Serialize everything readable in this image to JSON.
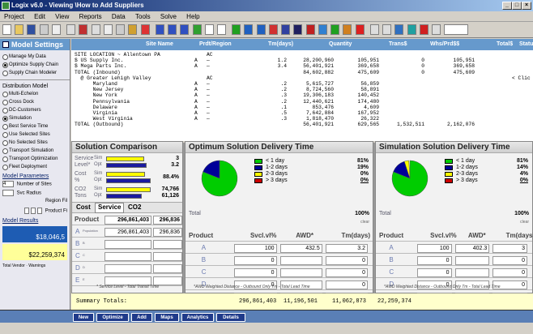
{
  "window": {
    "title": "Logix v6.0 - Viewing \\How to Add Suppliers"
  },
  "menu": [
    "Project",
    "Edit",
    "View",
    "Reports",
    "Data",
    "Tools",
    "Solve",
    "Help"
  ],
  "sidebar": {
    "title": "Model Settings",
    "solve_modes": [
      "Manage My Data",
      "Optimize Supply Chain",
      "Supply Chain Modeler"
    ],
    "distribution_title": "Distribution Model",
    "distribution_items": [
      "Multi-Echelon",
      "Cross Dock",
      "DC-Customers",
      "Simulation",
      "Best Service Time",
      "Use Selected Sites",
      "No Selected Sites",
      "Transport Simulation",
      "Transport Optimization",
      "Fleet Deployment"
    ],
    "params_title": "Model Parameters",
    "num_sites_label": "Number of Sites",
    "num_sites_value": "4",
    "svc_radius_label": "Svc Radius",
    "region_label": "Region Fil",
    "product_label": "Product Fi",
    "results_title": "Model Results",
    "result1": "$18,046,5",
    "result2": "$22,259,374",
    "total_vendor": "Total Vendor",
    "warnings": "Warnings"
  },
  "grid": {
    "headers": [
      "Site Name",
      "Prdt/Region",
      "Tm(days)",
      "Quantity",
      "Trans$",
      "Whs/Prd$$",
      "Total$",
      "Statu"
    ],
    "rows": [
      [
        "SITE LOCATION ~ Allentown PA",
        "",
        "AC",
        "",
        "",
        "",
        "",
        "",
        ""
      ],
      [
        "$ US Supply Inc.",
        "A",
        "—",
        "1.2",
        "28,200,960",
        "105,951",
        "0",
        "105,951",
        ""
      ],
      [
        "$ Mega Parts Inc.",
        "A",
        "—",
        "3.4",
        "56,401,921",
        "369,658",
        "0",
        "369,658",
        ""
      ],
      [
        "TOTAL (Inbound)",
        "",
        "",
        "",
        "84,602,882",
        "475,609",
        "0",
        "475,609",
        ""
      ],
      [
        "  @ Greater Lehigh Valley",
        "",
        "AC",
        "",
        "",
        "",
        "",
        "",
        "< Clic"
      ],
      [
        "      Maryland",
        "A",
        "—",
        ".2",
        "5,615,727",
        "56,859",
        "",
        "",
        ""
      ],
      [
        "      New Jersey",
        "A",
        "—",
        ".2",
        "8,724,560",
        "58,891",
        "",
        "",
        ""
      ],
      [
        "      New York",
        "A",
        "—",
        ".3",
        "19,306,183",
        "140,452",
        "",
        "",
        ""
      ],
      [
        "      Pennsylvania",
        "A",
        "—",
        ".2",
        "12,440,621",
        "174,480",
        "",
        "",
        ""
      ],
      [
        "      Delaware",
        "A",
        "—",
        ".1",
        "853,476",
        "4,609",
        "",
        "",
        ""
      ],
      [
        "      Virginia",
        "A",
        "—",
        ".5",
        "7,642,884",
        "167,952",
        "",
        "",
        ""
      ],
      [
        "      West Virginia",
        "A",
        "—",
        ".3",
        "1,818,470",
        "26,322",
        "",
        "",
        ""
      ],
      [
        "TOTAL (Outbound)",
        "",
        "",
        "",
        "56,401,921",
        "629,565",
        "1,532,511",
        "2,162,076",
        ""
      ]
    ]
  },
  "comparison": {
    "title": "Solution Comparison",
    "rows": [
      {
        "label": "Service Level*",
        "sim": "Sim",
        "opt": "Opt",
        "value": "3",
        "value2": "3.2"
      },
      {
        "label": "Cost %",
        "sim": "Sim",
        "opt": "Opt",
        "value": "88.4%"
      },
      {
        "label": "CO2 Tons",
        "sim": "Sim",
        "opt": "Opt",
        "value": "74,766",
        "value2": "61,126"
      }
    ],
    "tabs": [
      "Cost",
      "Service",
      "CO2"
    ],
    "table_head": [
      "Product",
      "296,861,403",
      "296,836"
    ],
    "products": [
      {
        "name": "A",
        "sub": "Population",
        "v1": "296,861,403",
        "v2": "296,836"
      },
      {
        "name": "B",
        "sub": "B",
        "v1": "",
        "v2": ""
      },
      {
        "name": "C",
        "sub": "C",
        "v1": "",
        "v2": ""
      },
      {
        "name": "D",
        "sub": "D",
        "v1": "",
        "v2": ""
      },
      {
        "name": "E",
        "sub": "E",
        "v1": "",
        "v2": ""
      }
    ],
    "footnote": "* Service Level - Total Transit Time"
  },
  "optimum": {
    "title": "Optimum Solution Delivery Time",
    "legend": [
      {
        "label": "< 1 day",
        "pct": "81%",
        "color": "#00cc00"
      },
      {
        "label": "1-2 days",
        "pct": "19%",
        "color": "#000099"
      },
      {
        "label": "2-3 days",
        "pct": "0%",
        "color": "#ffff00"
      },
      {
        "label": "> 3 days",
        "pct": "0%",
        "color": "#cc0000"
      }
    ],
    "total_label": "Total",
    "total_pct": "100%",
    "clear": "clear",
    "head": [
      "Product",
      "Svcl.vl%",
      "AWD*",
      "Tm(days)"
    ],
    "rows": [
      {
        "p": "A",
        "s": "100",
        "a": "432.5",
        "t": "3.2"
      },
      {
        "p": "B",
        "s": "0",
        "a": "",
        "t": "0"
      },
      {
        "p": "C",
        "s": "0",
        "a": "",
        "t": "0"
      },
      {
        "p": "D",
        "s": "0",
        "a": "",
        "t": "0"
      },
      {
        "p": "E",
        "s": "0",
        "a": "",
        "t": "0"
      }
    ],
    "footnote": "*AWD Weighted Distance - Outbound Only     Tm - Total Lead Time"
  },
  "simulation": {
    "title": "Simulation Solution Delivery Time",
    "legend": [
      {
        "label": "< 1 day",
        "pct": "81%",
        "color": "#00cc00"
      },
      {
        "label": "1-2 days",
        "pct": "14%",
        "color": "#000099"
      },
      {
        "label": "2-3 days",
        "pct": "4%",
        "color": "#ffff00"
      },
      {
        "label": "> 3 days",
        "pct": "0%",
        "color": "#cc0000"
      }
    ],
    "total_label": "Total",
    "total_pct": "100%",
    "clear": "clear",
    "head": [
      "Product",
      "Svcl.vl%",
      "AWD*",
      "Tm(days)"
    ],
    "rows": [
      {
        "p": "A",
        "s": "100",
        "a": "402.3",
        "t": "3"
      },
      {
        "p": "B",
        "s": "0",
        "a": "",
        "t": "0"
      },
      {
        "p": "C",
        "s": "0",
        "a": "",
        "t": "0"
      },
      {
        "p": "D",
        "s": "0",
        "a": "",
        "t": "0"
      },
      {
        "p": "E",
        "s": "0",
        "a": "",
        "t": "0"
      }
    ],
    "footnote": "*AWD Weighted Distance - Outbound Only     Tm - Total Lead Time"
  },
  "summary": {
    "label": "Summary Totals:",
    "v1": "296,861,403",
    "v2": "11,196,501",
    "v3": "11,062,873",
    "v4": "22,259,374"
  },
  "bottom_buttons": [
    "New",
    "Optimize",
    "Add",
    "Maps",
    "Analytics",
    "Details"
  ]
}
